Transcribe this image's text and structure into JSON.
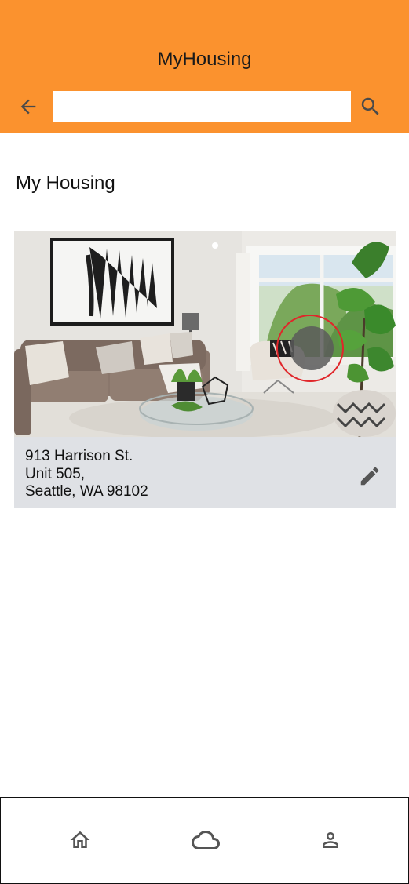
{
  "app_bar": {
    "title": "MyHousing",
    "background": "#fb922e",
    "back_icon": "arrow-left-icon",
    "search_icon": "search-icon",
    "search_value": ""
  },
  "page": {
    "title": "My Housing"
  },
  "housing_card": {
    "image": "living-room-photo",
    "address_line1": "913 Harrison St.",
    "address_line2": "Unit 505,",
    "address_line3": "Seattle, WA 98102",
    "edit_icon": "pencil-icon"
  },
  "bottom_nav": {
    "items": [
      {
        "icon": "home-icon"
      },
      {
        "icon": "cloud-icon"
      },
      {
        "icon": "person-icon"
      }
    ]
  }
}
